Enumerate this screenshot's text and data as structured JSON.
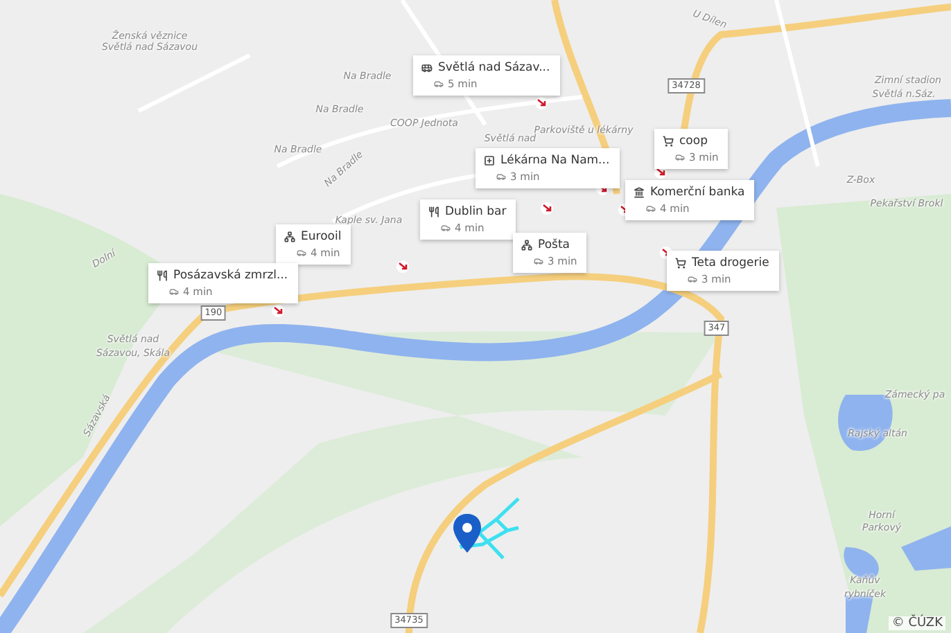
{
  "places": [
    {
      "name": "Světlá nad Sázav...",
      "kind": "bus",
      "time": "5 min"
    },
    {
      "name": "coop",
      "kind": "shop",
      "time": "3 min"
    },
    {
      "name": "Lékárna Na Nam...",
      "kind": "pharmacy",
      "time": "3 min"
    },
    {
      "name": "Komerční banka",
      "kind": "bank",
      "time": "4 min"
    },
    {
      "name": "Dublin bar",
      "kind": "restaurant",
      "time": "4 min"
    },
    {
      "name": "Eurooil",
      "kind": "network",
      "time": "4 min"
    },
    {
      "name": "Pošta",
      "kind": "network",
      "time": "3 min"
    },
    {
      "name": "Teta drogerie",
      "kind": "shop",
      "time": "3 min"
    },
    {
      "name": "Posázavská zmrzl...",
      "kind": "restaurant",
      "time": "4 min"
    }
  ],
  "map_labels": [
    "Ženská věznice",
    "Světlá nad Sázavou",
    "Na Bradle",
    "Na Bradle",
    "Na Bradle",
    "COOP Jednota",
    "Na Bradle",
    "Kaple sv. Jana",
    "Dolní",
    "Parkoviště u lékárny",
    "Světlá nad",
    "U Dílen",
    "Zimní stadion",
    "Světlá n.Sáz.",
    "Z-Box",
    "Pekařství Brokl",
    "Světlá nad",
    "Sázavou, Skála",
    "Sázavská",
    "Zámecký pa",
    "Rajský altán",
    "Horní",
    "Parkový",
    "Kaňův",
    "rybníček"
  ],
  "road_numbers": [
    "190",
    "34728",
    "347",
    "34735"
  ],
  "attribution": "© ČÚZK"
}
